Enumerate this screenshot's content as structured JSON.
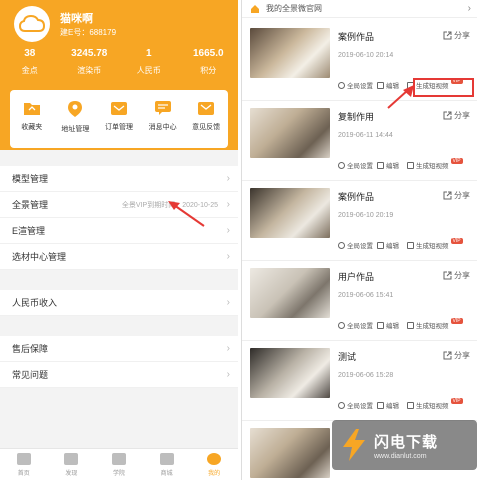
{
  "colors": {
    "accent": "#f7a624",
    "annotation": "#e53935"
  },
  "profile": {
    "name": "猫咪啊",
    "id_label": "建E号：688179"
  },
  "stats": [
    {
      "value": "38",
      "label": "金点"
    },
    {
      "value": "3245.78",
      "label": "渲染币"
    },
    {
      "value": "1",
      "label": "人民币"
    },
    {
      "value": "1665.0",
      "label": "积分"
    }
  ],
  "shortcuts": [
    {
      "label": "收藏夹",
      "icon": "folder-icon"
    },
    {
      "label": "地址管理",
      "icon": "location-icon"
    },
    {
      "label": "订单管理",
      "icon": "order-icon"
    },
    {
      "label": "消息中心",
      "icon": "message-icon"
    },
    {
      "label": "意见反馈",
      "icon": "feedback-icon"
    }
  ],
  "menu_group1": [
    {
      "label": "模型管理",
      "note": ""
    },
    {
      "label": "全景管理",
      "note": "全景VIP到期时间：2020-10-25"
    },
    {
      "label": "E渲管理",
      "note": ""
    },
    {
      "label": "选材中心管理",
      "note": ""
    }
  ],
  "menu_group2": [
    {
      "label": "人民币收入"
    }
  ],
  "menu_group3": [
    {
      "label": "售后保障"
    },
    {
      "label": "常见问题"
    }
  ],
  "tabbar": [
    {
      "label": "首页",
      "active": false
    },
    {
      "label": "发现",
      "active": false
    },
    {
      "label": "学院",
      "active": false
    },
    {
      "label": "商城",
      "active": false
    },
    {
      "label": "我的",
      "active": true
    }
  ],
  "right_panel": {
    "title": "我的全景微官网",
    "share_label": "分享",
    "action_settings": "全局设置",
    "action_edit": "编辑",
    "action_video": "生成短视频",
    "vip_badge": "VIP",
    "items": [
      {
        "title": "案例作品",
        "date": "2019-06-10 20:14"
      },
      {
        "title": "复制作用",
        "date": "2019-06-11 14:44"
      },
      {
        "title": "案例作品",
        "date": "2019-06-10 20:19"
      },
      {
        "title": "用户作品",
        "date": "2019-06-06 15:41"
      },
      {
        "title": "测试",
        "date": "2019-06-06 15:28"
      }
    ]
  },
  "watermark": {
    "brand": "闪电下载",
    "url": "www.dianlut.com"
  }
}
